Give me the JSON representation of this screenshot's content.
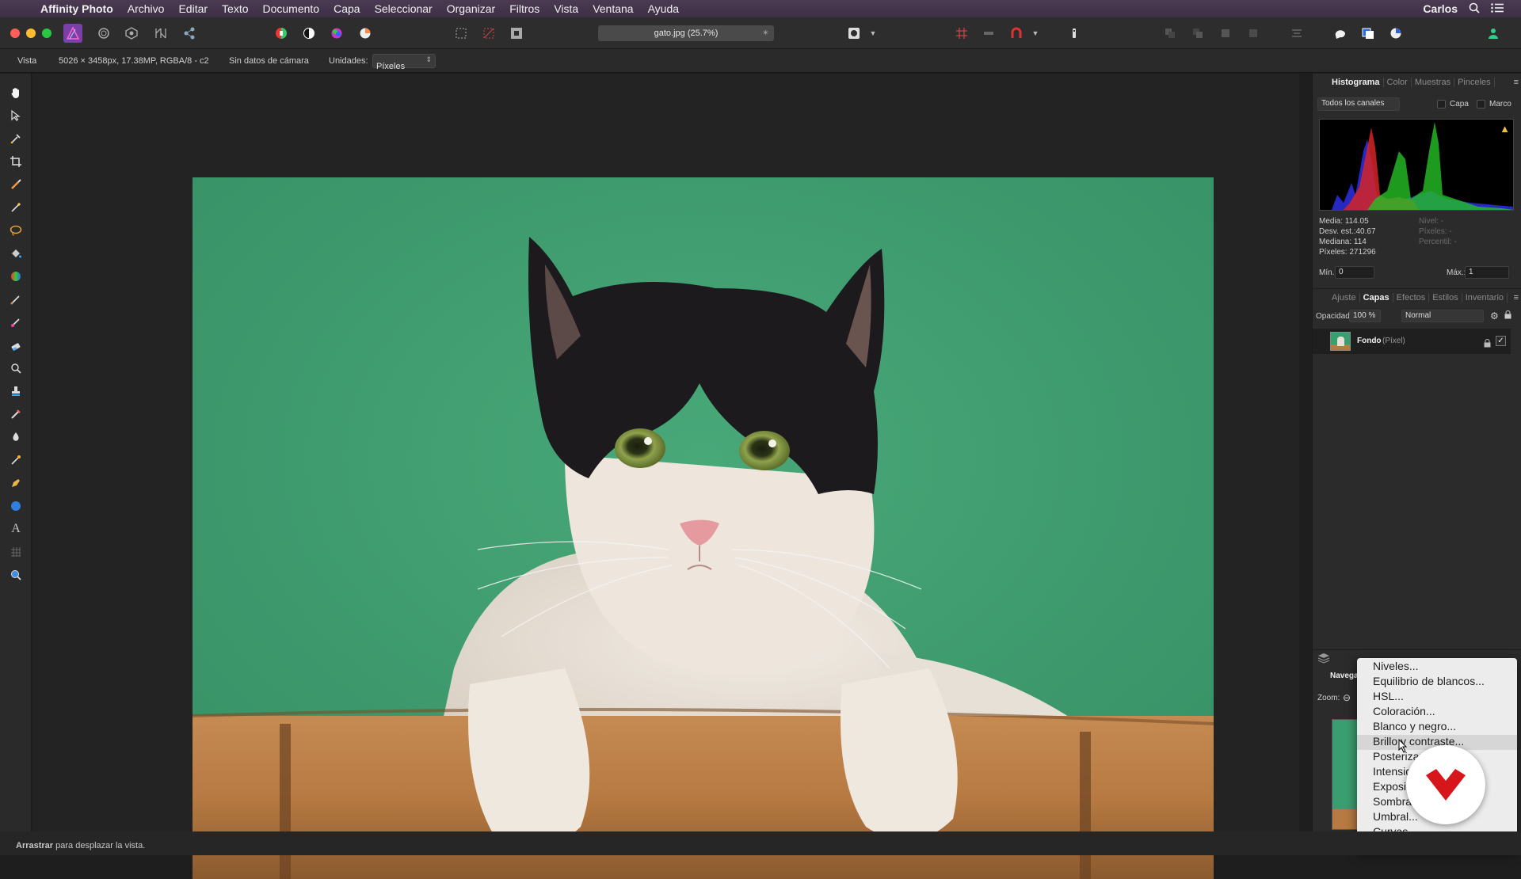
{
  "menubar": {
    "app_name": "Affinity Photo",
    "items": [
      "Archivo",
      "Editar",
      "Texto",
      "Documento",
      "Capa",
      "Seleccionar",
      "Organizar",
      "Filtros",
      "Vista",
      "Ventana",
      "Ayuda"
    ],
    "user": "Carlos"
  },
  "toolbar": {
    "document_tab": "gato.jpg (25.7%)"
  },
  "context": {
    "view_label": "Vista",
    "doc_info": "5026 × 3458px, 17.38MP, RGBA/8 - c2",
    "camera": "Sin datos de cámara",
    "units_label": "Unidades:",
    "units_value": "Píxeles"
  },
  "histogram": {
    "tabs": [
      "Histograma",
      "Color",
      "Muestras",
      "Pinceles"
    ],
    "channels": "Todos los canales",
    "capa_label": "Capa",
    "marco_label": "Marco",
    "media": "Media: 114.05",
    "desv": "Desv. est.:40.67",
    "mediana": "Mediana: 114",
    "pixeles": "Píxeles: 271296",
    "nivel": "Nivel: -",
    "pixeles_r": "Píxeles: -",
    "percentil": "Percentil: -",
    "min_label": "Mín.:",
    "min_value": "0",
    "max_label": "Máx.:",
    "max_value": "1"
  },
  "layers": {
    "tabs": [
      "Ajuste",
      "Capas",
      "Efectos",
      "Estilos",
      "Inventario"
    ],
    "opacity_label": "Opacidad:",
    "opacity_value": "100 %",
    "blend_mode": "Normal",
    "layer_name": "Fondo",
    "layer_type": "(Píxel)"
  },
  "navigator": {
    "tab": "Navega",
    "zoom_label": "Zoom:"
  },
  "adjust_menu": {
    "items": [
      "Niveles...",
      "Equilibrio de blancos...",
      "HSL...",
      "Coloración...",
      "Blanco y negro...",
      "Brillo y contraste...",
      "Posterizar...",
      "Intensidad...",
      "Exposición...",
      "Sombras y reflejos...",
      "Umbral...",
      "Curvas..."
    ],
    "highlighted_index": 5
  },
  "status": {
    "bold": "Arrastrar",
    "text": "para desplazar la vista."
  },
  "colors": {
    "canvas_bg": "#232323",
    "photo_wall": "#3f9f72",
    "photo_bamboo": "#b9814a"
  }
}
